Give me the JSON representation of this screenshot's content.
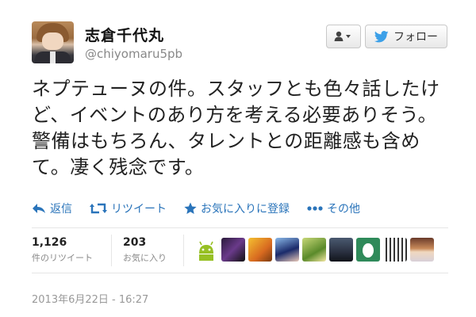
{
  "user": {
    "display_name": "志倉千代丸",
    "handle": "@chiyomaru5pb"
  },
  "buttons": {
    "follow_label": "フォロー"
  },
  "tweet": {
    "text": "ネプテューヌの件。スタッフとも色々話したけど、イベントのあり方を考える必要ありそう。警備はもちろん、タレントとの距離感も含めて。凄く残念です。"
  },
  "actions": [
    {
      "icon": "reply-icon",
      "label": "返信"
    },
    {
      "icon": "retweet-icon",
      "label": "リツイート"
    },
    {
      "icon": "star-icon",
      "label": "お気に入りに登録"
    },
    {
      "icon": "more-icon",
      "label": "その他"
    }
  ],
  "stats": {
    "retweets": {
      "count": "1,126",
      "label": "件のリツイート"
    },
    "favorites": {
      "count": "203",
      "label": "お気に入り"
    }
  },
  "timestamp": "2013年6月22日 - 16:27",
  "colors": {
    "link": "#2a74ba",
    "twitter_bird": "#3ca0e8"
  },
  "favoriters": [
    {
      "name": "favoriter-android"
    },
    {
      "name": "favoriter-2"
    },
    {
      "name": "favoriter-3"
    },
    {
      "name": "favoriter-4"
    },
    {
      "name": "favoriter-5"
    },
    {
      "name": "favoriter-6"
    },
    {
      "name": "favoriter-7"
    },
    {
      "name": "favoriter-8"
    },
    {
      "name": "favoriter-9"
    },
    {
      "name": "favoriter-10"
    }
  ]
}
